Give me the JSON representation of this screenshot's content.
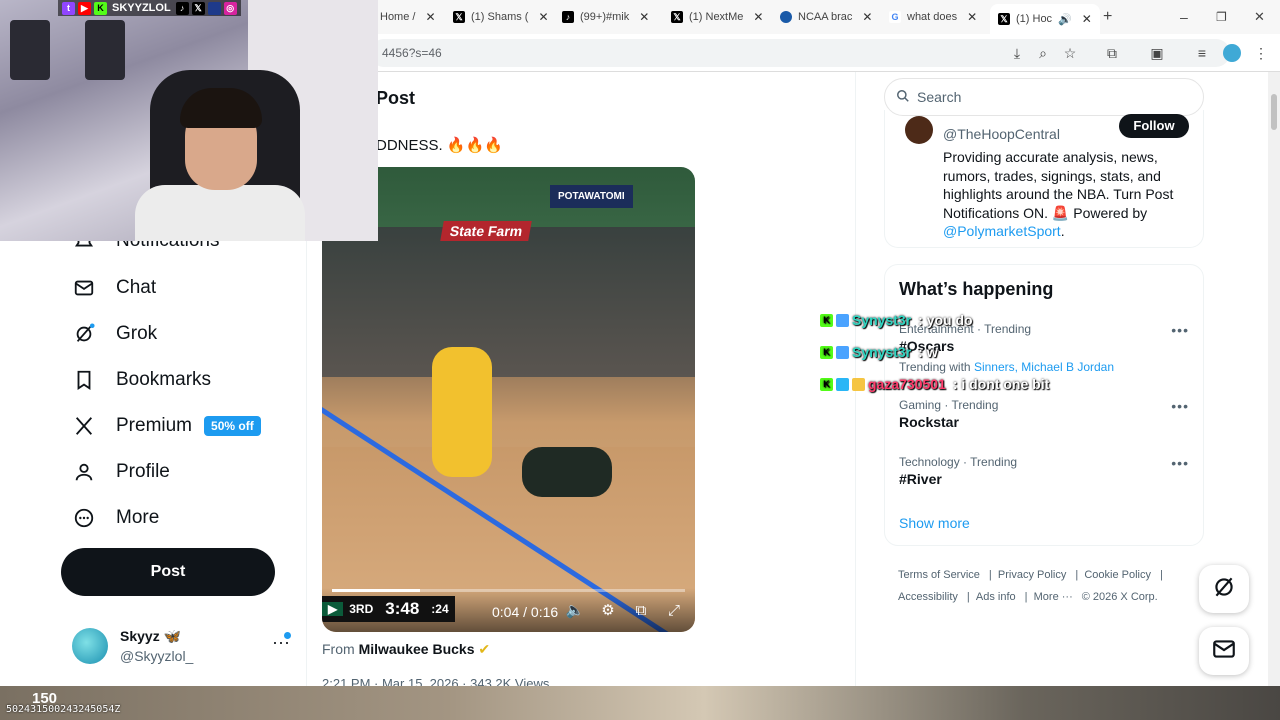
{
  "browser": {
    "tabs": [
      {
        "label": "Home /",
        "icon": "x-logo"
      },
      {
        "label": "(1) Shams (",
        "icon": "x-logo"
      },
      {
        "label": "(99+)#mik",
        "icon": "tiktok-logo"
      },
      {
        "label": "(1) NextMe",
        "icon": "x-logo"
      },
      {
        "label": "NCAA brac",
        "icon": "ncaa-logo"
      },
      {
        "label": "what does",
        "icon": "google-logo"
      },
      {
        "label": "(1) Hoc",
        "icon": "x-logo",
        "active": true
      }
    ],
    "url": "4456?s=46"
  },
  "stream_overlay": {
    "handle": "SKYYZLOL"
  },
  "sidebar": {
    "items": [
      {
        "label": "Notifications",
        "icon": "bell-icon"
      },
      {
        "label": "Chat",
        "icon": "mail-icon"
      },
      {
        "label": "Grok",
        "icon": "grok-icon"
      },
      {
        "label": "Bookmarks",
        "icon": "bookmark-icon"
      },
      {
        "label": "Premium",
        "icon": "x-icon",
        "badge": "50% off"
      },
      {
        "label": "Profile",
        "icon": "person-icon"
      },
      {
        "label": "More",
        "icon": "more-circle-icon"
      }
    ],
    "post_button": "Post",
    "account": {
      "name": "Skyyz 🦋",
      "handle": "@Skyyzlol_"
    }
  },
  "main": {
    "title": "Post",
    "tweet_text": "DDNESS. 🔥🔥🔥",
    "video": {
      "sponsor_a": "State Farm",
      "sponsor_b": "POTAWATOMI",
      "scorebug": {
        "period": "3RD",
        "clock": "3:48",
        "shot_clock": ":24"
      },
      "time": "0:04 / 0:16",
      "progress": 0.25
    },
    "from_prefix": "From",
    "from_name": "Milwaukee Bucks",
    "meta": "2:21 PM · Mar 15, 2026 · 343.2K Views"
  },
  "right": {
    "search_placeholder": "Search",
    "profile_card": {
      "handle": "@TheHoopCentral",
      "follow": "Follow",
      "bio": "Providing accurate analysis, news, rumors, trades, signings, stats, and highlights around the NBA. Turn Post Notifications ON. 🚨 Powered by",
      "link": "@PolymarketSport"
    },
    "happening": {
      "title": "What’s happening",
      "trends": [
        {
          "category": "Entertainment · Trending",
          "name": "#Oscars"
        },
        {
          "category": "Trending with",
          "name": "Sinners, Michael B Jordan"
        },
        {
          "category": "Gaming · Trending",
          "name": "Rockstar"
        },
        {
          "category": "Technology · Trending",
          "name": "#River"
        }
      ],
      "show_more": "Show more"
    },
    "footer": [
      "Terms of Service",
      "Privacy Policy",
      "Cookie Policy",
      "Accessibility",
      "Ads info",
      "More ···",
      "© 2026 X Corp."
    ]
  },
  "chat": [
    {
      "user": "Synyst3r",
      "msg": ": you do",
      "color": "#2fd6c2"
    },
    {
      "user": "Synyst3r",
      "msg": ": w",
      "color": "#2fd6c2"
    },
    {
      "user": "gaza730501",
      "msg": ": i dont one bit",
      "color": "#ff3b6b"
    }
  ],
  "game_strip": {
    "value": "150",
    "code": "502431500243245054Z"
  }
}
